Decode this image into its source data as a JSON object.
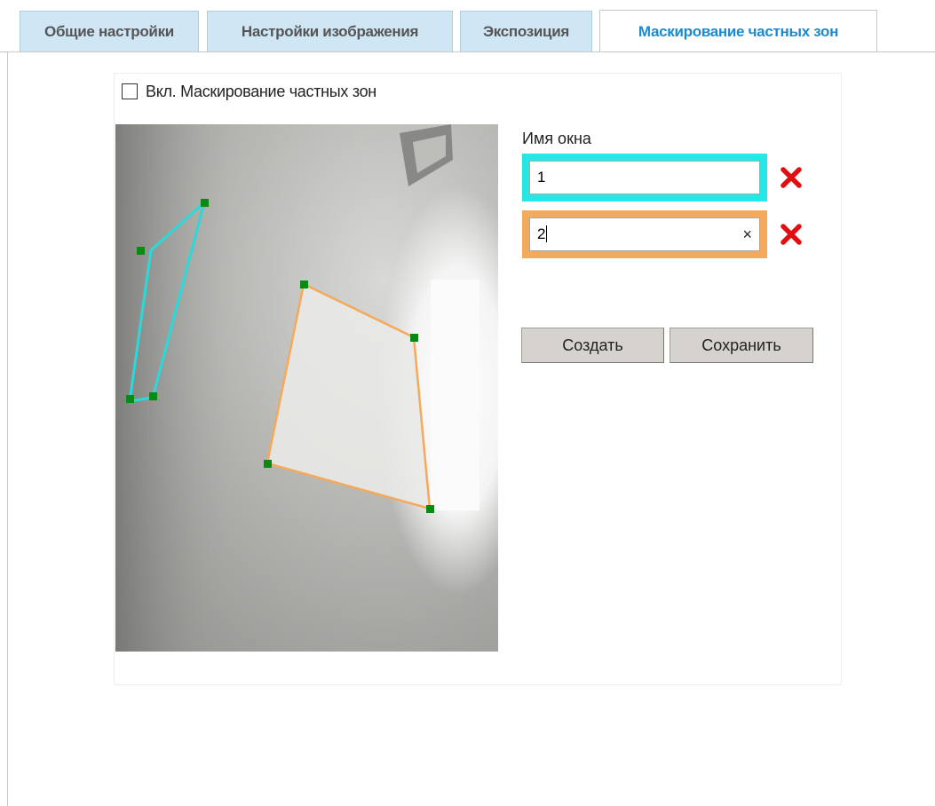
{
  "tabs": [
    {
      "label": "Общие настройки"
    },
    {
      "label": "Настройки изображения"
    },
    {
      "label": "Экспозиция"
    },
    {
      "label": "Маскирование частных зон"
    }
  ],
  "enable": {
    "label": "Вкл. Маскирование частных зон",
    "checked": false
  },
  "masks": {
    "name_label": "Имя окна",
    "items": [
      {
        "name": "1",
        "color": "#27e6e6"
      },
      {
        "name": "2",
        "color": "#f5a95a",
        "clear_glyph": "×"
      }
    ],
    "delete_icon": "red-x-icon"
  },
  "buttons": {
    "create": "Создать",
    "save": "Сохранить"
  },
  "colors": {
    "active_tab": "#1a8bd0",
    "tab_bg": "#cfe6f5",
    "delete": "#e01010"
  }
}
